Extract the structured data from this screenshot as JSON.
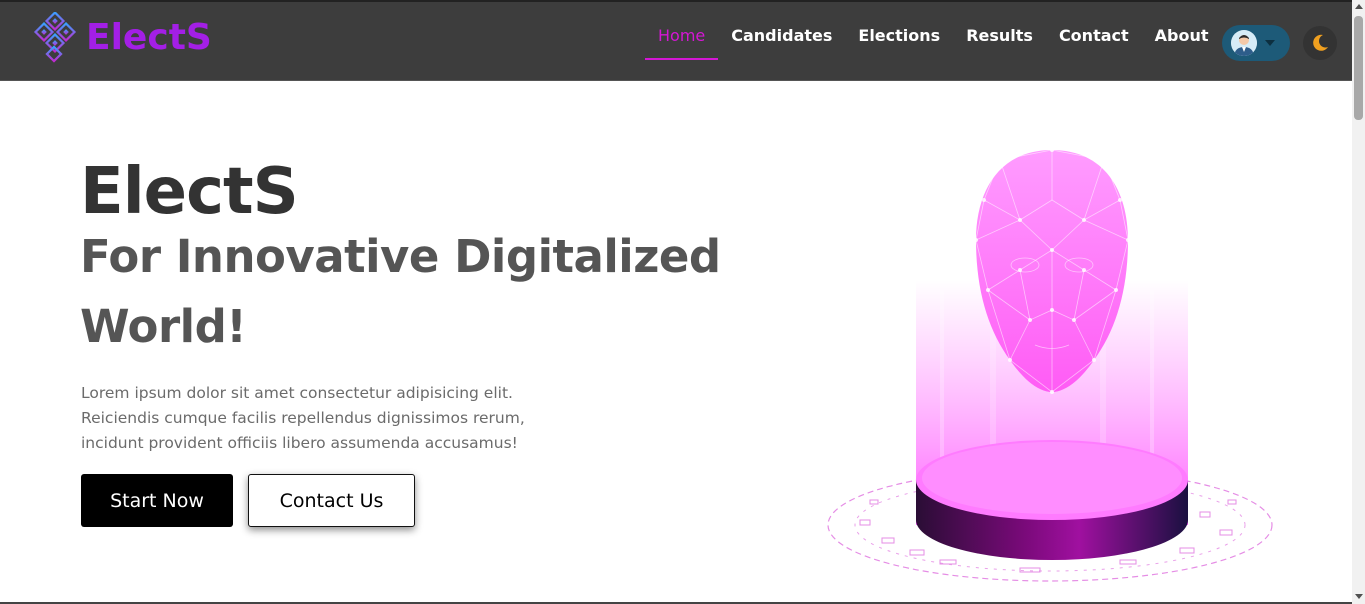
{
  "brand": {
    "name": "ElectS",
    "color": "#a31fe6",
    "logo_icon": "diamond-grid-logo-icon"
  },
  "nav": {
    "items": [
      {
        "label": "Home",
        "active": true
      },
      {
        "label": "Candidates",
        "active": false
      },
      {
        "label": "Elections",
        "active": false
      },
      {
        "label": "Results",
        "active": false
      },
      {
        "label": "Contact",
        "active": false
      },
      {
        "label": "About",
        "active": false
      }
    ],
    "active_color": "#d417d4",
    "user_icon": "user-avatar-icon",
    "theme_icon": "moon-icon"
  },
  "hero": {
    "title": "ElectS",
    "subtitle_line1": "For Innovative Digitalized",
    "subtitle_line2": "World!",
    "description": "Lorem ipsum dolor sit amet consectetur adipisicing elit. Reiciendis cumque facilis repellendus dignissimos rerum, incidunt provident officiis libero assumenda accusamus!",
    "primary_button": "Start Now",
    "secondary_button": "Contact Us",
    "illustration_icon": "hologram-face-podium-icon"
  },
  "colors": {
    "navbar": "#3d3d3d",
    "accent": "#d417d4",
    "hologram": "#ff7bff",
    "moon": "#f0a020"
  }
}
